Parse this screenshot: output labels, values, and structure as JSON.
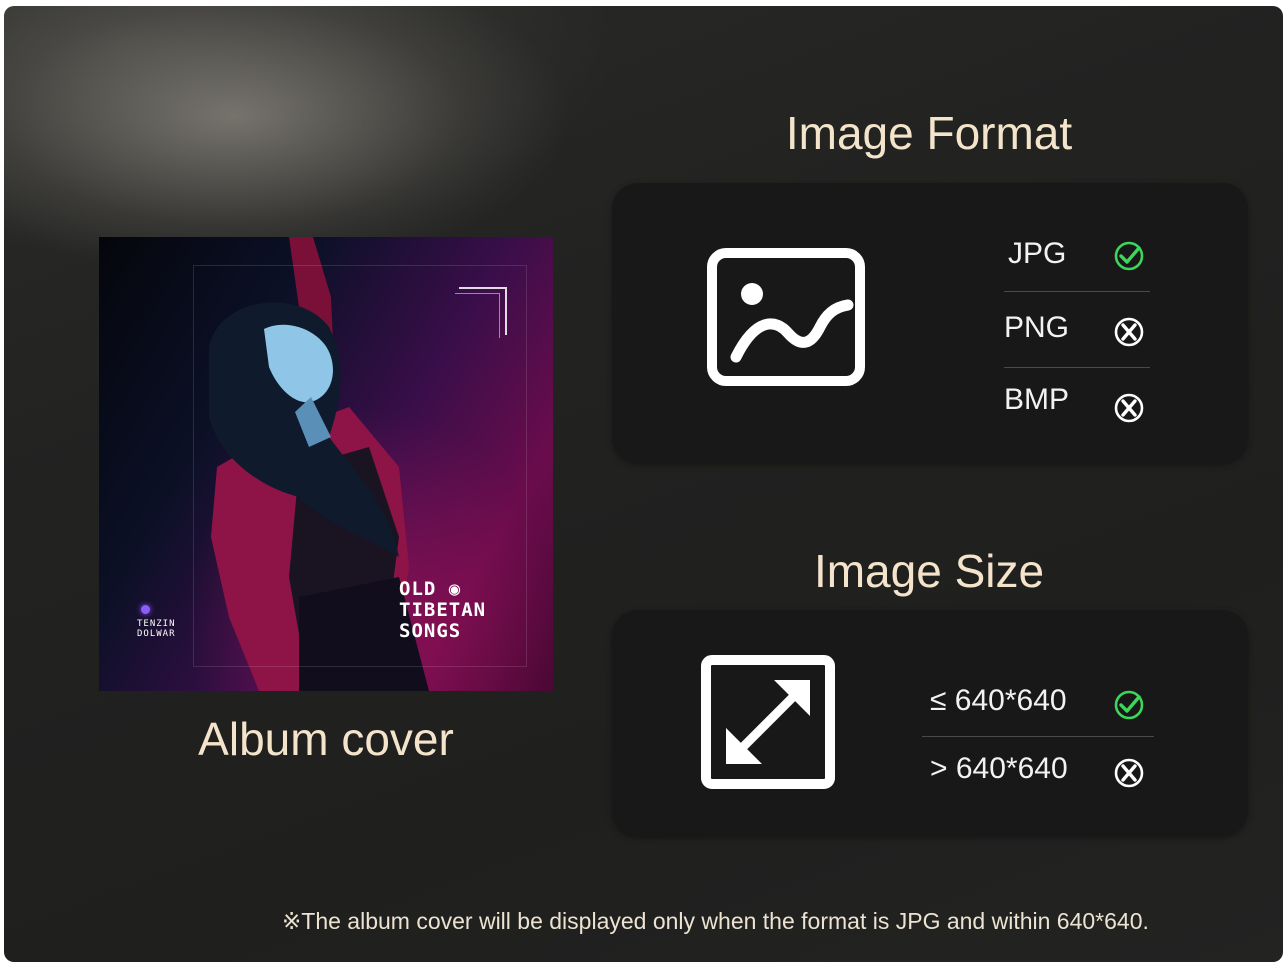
{
  "album": {
    "label": "Album cover",
    "cover": {
      "title_lines": "OLD ◉\nTIBETAN\nSONGS",
      "artist_lines": "TENZIN\nDOLWAR"
    }
  },
  "format": {
    "title": "Image Format",
    "icon": "image-icon",
    "options": [
      {
        "label": "JPG",
        "status": "accepted"
      },
      {
        "label": "PNG",
        "status": "rejected"
      },
      {
        "label": "BMP",
        "status": "rejected"
      }
    ]
  },
  "size": {
    "title": "Image Size",
    "icon": "resize-icon",
    "options": [
      {
        "label": "≤ 640*640",
        "status": "accepted"
      },
      {
        "label": "> 640*640",
        "status": "rejected"
      }
    ]
  },
  "footnote": "※The album cover will be displayed only when the format is JPG and within 640*640.",
  "colors": {
    "accepted": "#3cd65a",
    "rejected": "#ffffff",
    "heading": "#f3e4cb"
  }
}
